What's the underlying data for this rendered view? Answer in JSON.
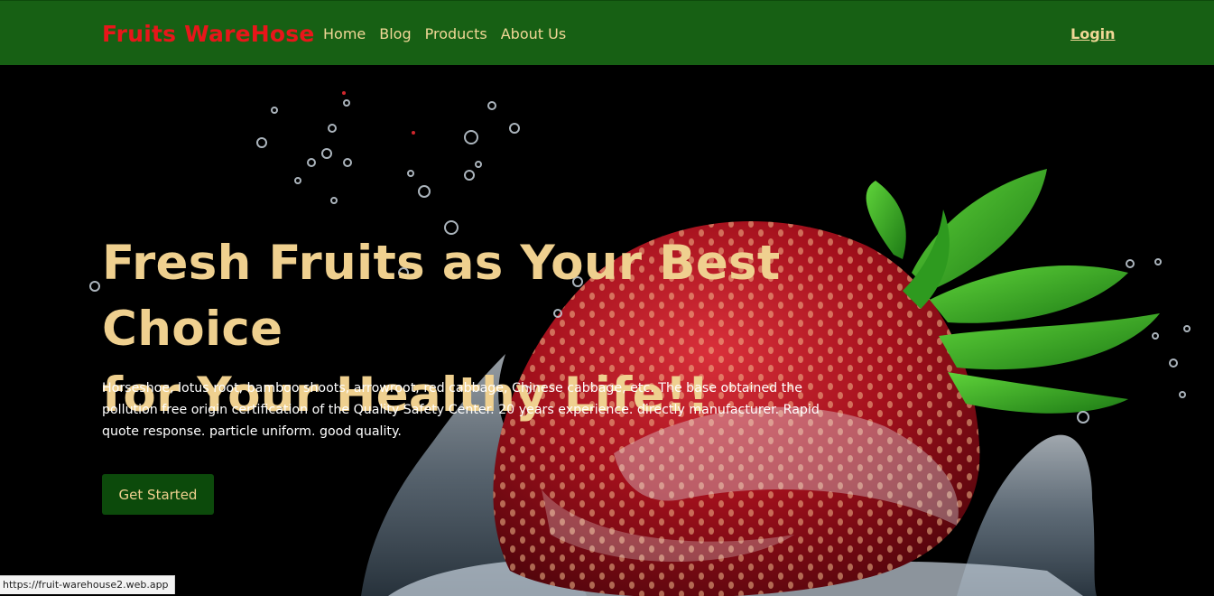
{
  "navbar": {
    "brand": "Fruits WareHose",
    "links": [
      "Home",
      "Blog",
      "Products",
      "About Us"
    ],
    "login": "Login"
  },
  "hero": {
    "title_line1": "Fresh Fruits as Your Best Choice",
    "title_line2": "for Your Healthy Life!!",
    "description": "Horseshoe, lotus root, bamboo shoots, arrowroot, red cabbage, Chinese cabbage, etc. The base obtained the pollution free origin certification of the Quality Safety Center. 20 years experience. directly manufacturer. Rapid quote response. particle uniform. good quality.",
    "cta_label": "Get Started",
    "background_image": "strawberry-splash"
  },
  "status_bar": {
    "url": "https://fruit-warehouse2.web.app"
  },
  "colors": {
    "navbar_bg": "#176014",
    "brand": "#e8161a",
    "accent_text": "#efd08f",
    "cta_bg": "#0c4a0b",
    "hero_bg": "#000000"
  }
}
